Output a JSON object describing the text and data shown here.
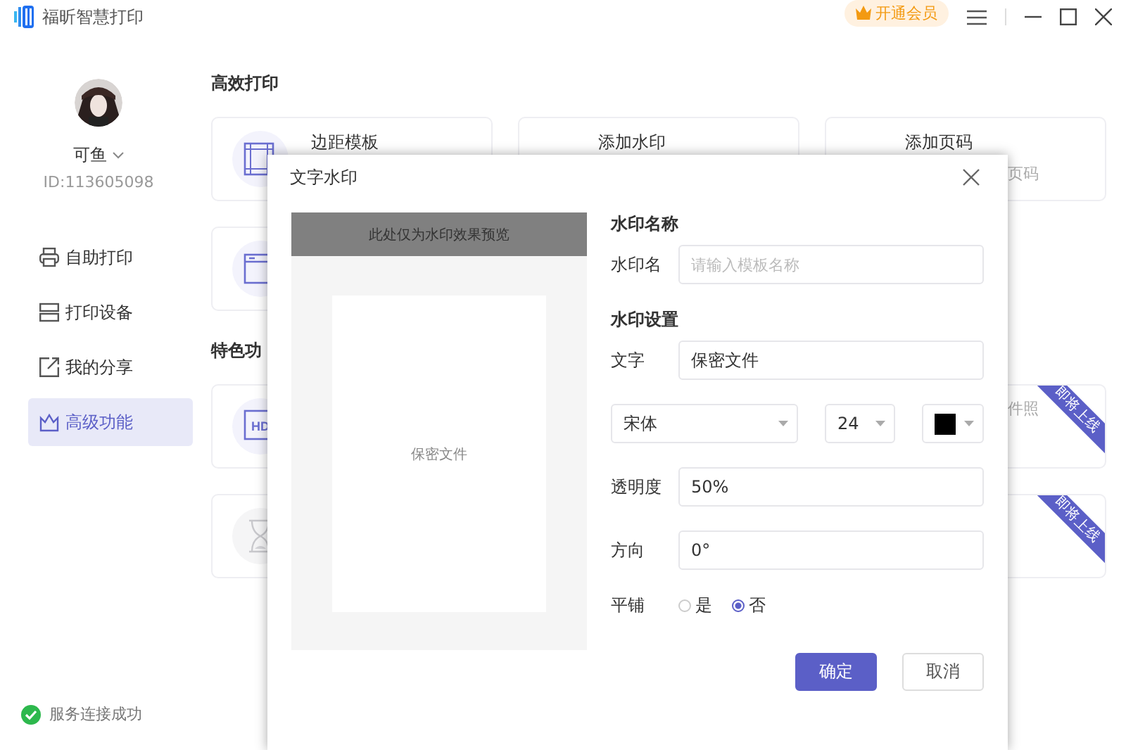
{
  "app": {
    "title": "福昕智慧打印",
    "vip_label": "开通会员"
  },
  "user": {
    "name": "可鱼",
    "id": "ID:113605098"
  },
  "nav": [
    {
      "label": "自助打印",
      "selected": false
    },
    {
      "label": "打印设备",
      "selected": false
    },
    {
      "label": "我的分享",
      "selected": false
    },
    {
      "label": "高级功能",
      "selected": true
    }
  ],
  "status": {
    "text": "服务连接成功"
  },
  "sections": [
    {
      "title": "高效打印",
      "cards": [
        {
          "title": "边距模板",
          "disabled": false
        },
        {
          "title": "添加水印"
        },
        {
          "title": "添加页码",
          "subtitle": "页码"
        },
        {
          "disabled": false
        }
      ]
    },
    {
      "title": "特色功",
      "cards": [
        {
          "icon_text": "HD",
          "disabled": false
        },
        {
          "subtitle": "件照",
          "badge": "即将上线"
        },
        {
          "disabled": true
        },
        {
          "badge": "即将上线"
        }
      ]
    }
  ],
  "dialog": {
    "title": "文字水印",
    "preview_banner": "此处仅为水印效果预览",
    "preview_text": "保密文件",
    "name_section": "水印名称",
    "name_label": "水印名",
    "name_placeholder": "请输入模板名称",
    "settings_section": "水印设置",
    "text_label": "文字",
    "text_value": "保密文件",
    "font": "宋体",
    "size": "24",
    "color": "#000000",
    "opacity_label": "透明度",
    "opacity_value": "50%",
    "direction_label": "方向",
    "direction_value": "0°",
    "tile_label": "平铺",
    "tile_options": [
      {
        "label": "是",
        "selected": false
      },
      {
        "label": "否",
        "selected": true
      }
    ],
    "buttons": [
      {
        "label": "确定",
        "kind": "primary"
      },
      {
        "label": "取消",
        "kind": "secondary"
      }
    ]
  }
}
